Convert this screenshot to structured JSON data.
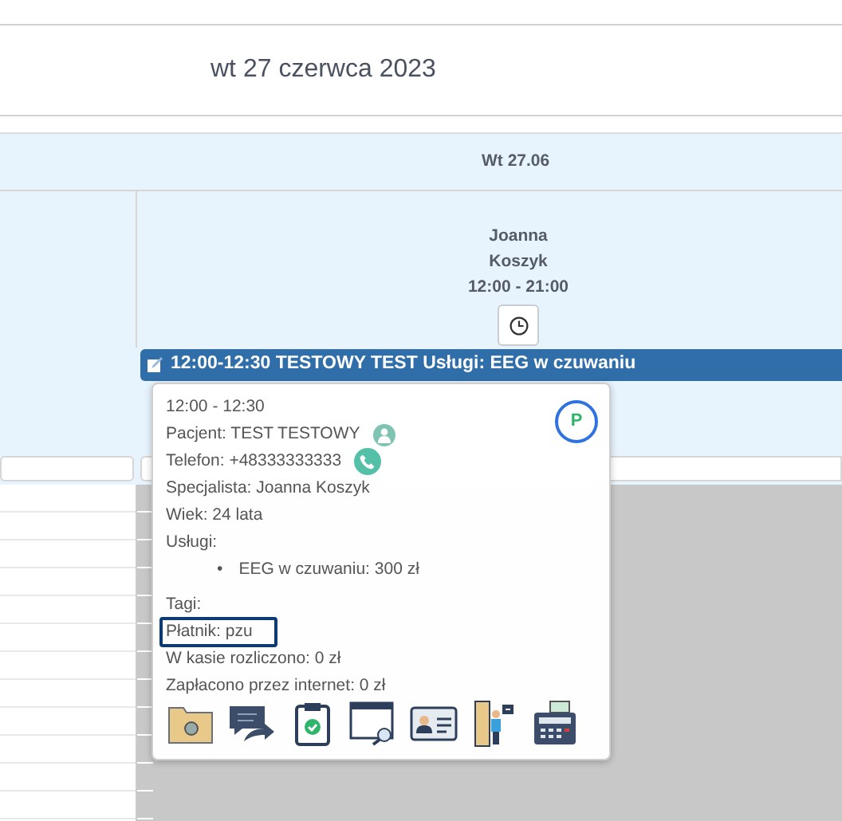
{
  "header": {
    "date": "wt 27 czerwca 2023"
  },
  "day": {
    "label": "Wt 27.06",
    "specialist": {
      "first_name": "Joanna",
      "last_name": "Koszyk",
      "hours": "12:00 - 21:00"
    }
  },
  "event": {
    "title": "12:00-12:30 TESTOWY TEST Usługi: EEG w czuwaniu"
  },
  "popover": {
    "time": "12:00 - 12:30",
    "badge": "P",
    "rows": [
      {
        "kind": "patient",
        "text": "Pacjent: TEST TESTOWY",
        "highlighted": false
      },
      {
        "kind": "phone",
        "text": "Telefon: +48333333333",
        "highlighted": false
      },
      {
        "kind": "line",
        "text": "Specjalista: Joanna Koszyk",
        "highlighted": false
      },
      {
        "kind": "line",
        "text": "Wiek: 24 lata",
        "highlighted": false
      },
      {
        "kind": "line",
        "text": "Usługi:",
        "highlighted": false
      },
      {
        "kind": "list",
        "items": [
          {
            "bullet": "•",
            "text": "EEG w czuwaniu: 300 zł"
          }
        ]
      },
      {
        "kind": "line",
        "text": "Tagi:",
        "highlighted": false
      },
      {
        "kind": "line",
        "text": "Płatnik: pzu",
        "highlighted": true
      },
      {
        "kind": "line",
        "text": "W kasie rozliczono: 0 zł",
        "highlighted": false
      },
      {
        "kind": "line",
        "text": "Zapłacono przez internet: 0 zł",
        "highlighted": false
      }
    ],
    "actions": [
      {
        "kind": "folder"
      },
      {
        "kind": "forward"
      },
      {
        "kind": "clipboard"
      },
      {
        "kind": "window-search"
      },
      {
        "kind": "id-card"
      },
      {
        "kind": "door"
      },
      {
        "kind": "register"
      }
    ]
  }
}
